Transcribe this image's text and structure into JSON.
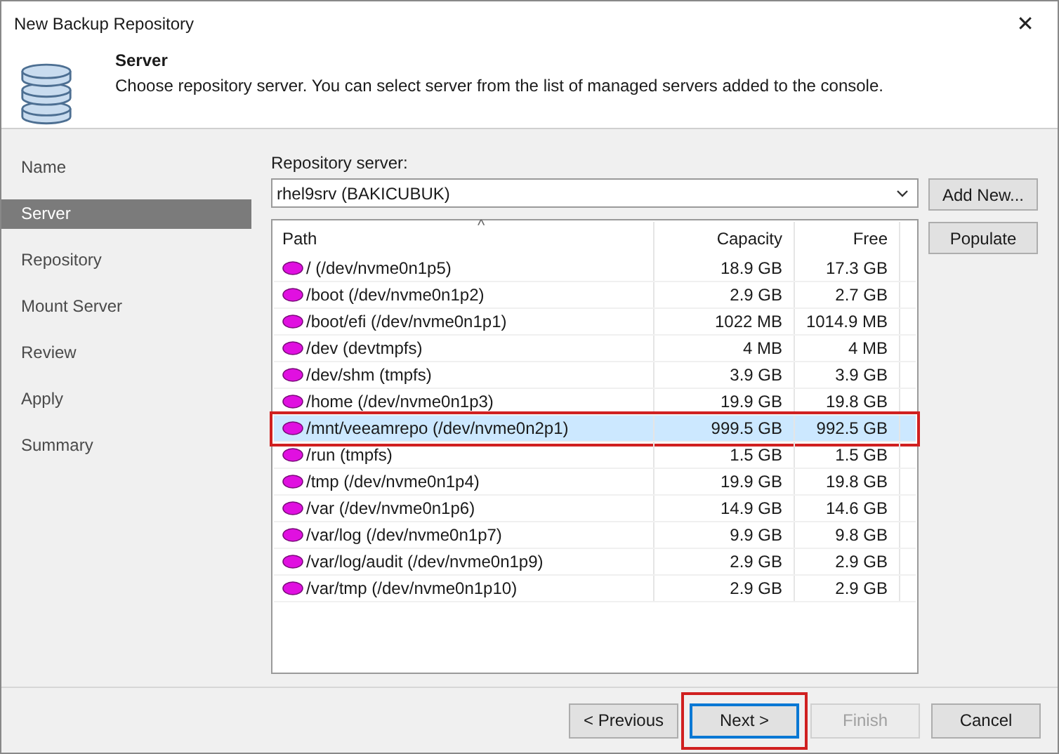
{
  "window": {
    "title": "New Backup Repository",
    "close": "✕"
  },
  "header": {
    "title": "Server",
    "description": "Choose repository server. You can select server from the list of managed servers added to the console."
  },
  "steps": [
    {
      "label": "Name",
      "selected": false
    },
    {
      "label": "Server",
      "selected": true
    },
    {
      "label": "Repository",
      "selected": false
    },
    {
      "label": "Mount Server",
      "selected": false
    },
    {
      "label": "Review",
      "selected": false
    },
    {
      "label": "Apply",
      "selected": false
    },
    {
      "label": "Summary",
      "selected": false
    }
  ],
  "server": {
    "label": "Repository server:",
    "value": "rhel9srv (BAKICUBUK)"
  },
  "side_buttons": [
    "Add New...",
    "Populate"
  ],
  "table": {
    "columns": [
      "Path",
      "Capacity",
      "Free"
    ],
    "sort_mark": "^",
    "rows": [
      {
        "path": "/ (/dev/nvme0n1p5)",
        "capacity": "18.9 GB",
        "free": "17.3 GB",
        "selected": false,
        "annotated": false
      },
      {
        "path": "/boot (/dev/nvme0n1p2)",
        "capacity": "2.9 GB",
        "free": "2.7 GB",
        "selected": false,
        "annotated": false
      },
      {
        "path": "/boot/efi (/dev/nvme0n1p1)",
        "capacity": "1022 MB",
        "free": "1014.9 MB",
        "selected": false,
        "annotated": false
      },
      {
        "path": "/dev (devtmpfs)",
        "capacity": "4 MB",
        "free": "4 MB",
        "selected": false,
        "annotated": false
      },
      {
        "path": "/dev/shm (tmpfs)",
        "capacity": "3.9 GB",
        "free": "3.9 GB",
        "selected": false,
        "annotated": false
      },
      {
        "path": "/home (/dev/nvme0n1p3)",
        "capacity": "19.9 GB",
        "free": "19.8 GB",
        "selected": false,
        "annotated": false
      },
      {
        "path": "/mnt/veeamrepo (/dev/nvme0n2p1)",
        "capacity": "999.5 GB",
        "free": "992.5 GB",
        "selected": true,
        "annotated": true
      },
      {
        "path": "/run (tmpfs)",
        "capacity": "1.5 GB",
        "free": "1.5 GB",
        "selected": false,
        "annotated": false
      },
      {
        "path": "/tmp (/dev/nvme0n1p4)",
        "capacity": "19.9 GB",
        "free": "19.8 GB",
        "selected": false,
        "annotated": false
      },
      {
        "path": "/var (/dev/nvme0n1p6)",
        "capacity": "14.9 GB",
        "free": "14.6 GB",
        "selected": false,
        "annotated": false
      },
      {
        "path": "/var/log (/dev/nvme0n1p7)",
        "capacity": "9.9 GB",
        "free": "9.8 GB",
        "selected": false,
        "annotated": false
      },
      {
        "path": "/var/log/audit (/dev/nvme0n1p9)",
        "capacity": "2.9 GB",
        "free": "2.9 GB",
        "selected": false,
        "annotated": false
      },
      {
        "path": "/var/tmp (/dev/nvme0n1p10)",
        "capacity": "2.9 GB",
        "free": "2.9 GB",
        "selected": false,
        "annotated": false
      }
    ]
  },
  "footer_buttons": [
    {
      "label": "< Previous",
      "disabled": false,
      "focused": false,
      "annotated": false
    },
    {
      "label": "Next >",
      "disabled": false,
      "focused": true,
      "annotated": true
    },
    {
      "label": "Finish",
      "disabled": true,
      "focused": false,
      "annotated": false
    },
    {
      "label": "Cancel",
      "disabled": false,
      "focused": false,
      "annotated": false
    }
  ]
}
